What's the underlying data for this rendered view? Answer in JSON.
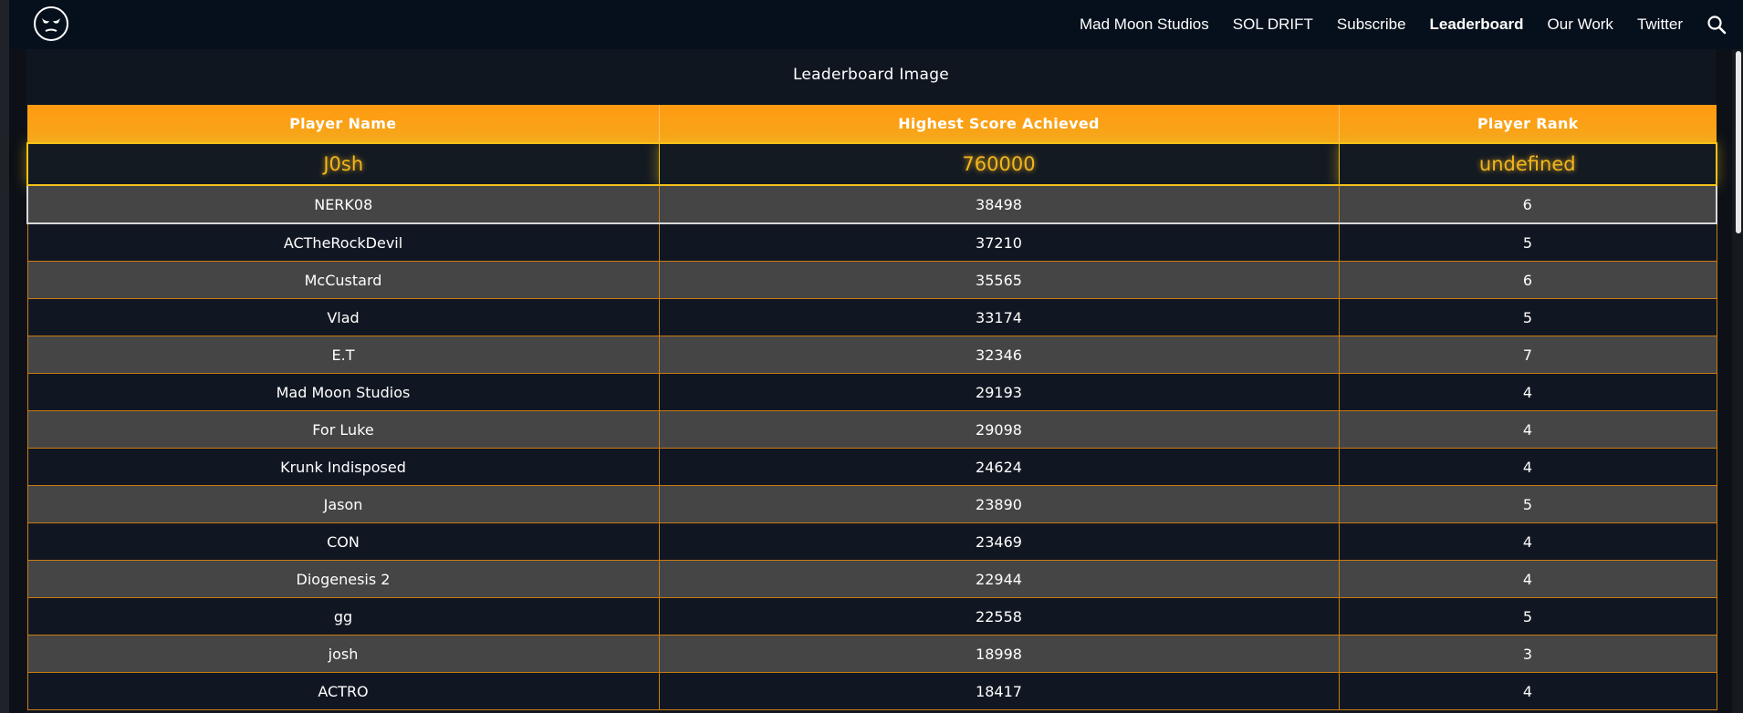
{
  "nav": {
    "logo_icon": "alien-face-icon",
    "links": [
      "Mad Moon Studios",
      "SOL DRIFT",
      "Subscribe",
      "Leaderboard",
      "Our Work",
      "Twitter"
    ],
    "active_link": "Leaderboard",
    "search_icon": "search-icon"
  },
  "page": {
    "title": "Leaderboard Image"
  },
  "leaderboard": {
    "headers": [
      "Player Name",
      "Highest Score Achieved",
      "Player Rank"
    ],
    "highlight": {
      "name": "J0sh",
      "score": "760000",
      "rank": "undefined"
    },
    "rows": [
      {
        "name": "NERK08",
        "score": "38498",
        "rank": "6"
      },
      {
        "name": "ACTheRockDevil",
        "score": "37210",
        "rank": "5"
      },
      {
        "name": "McCustard",
        "score": "35565",
        "rank": "6"
      },
      {
        "name": "Vlad",
        "score": "33174",
        "rank": "5"
      },
      {
        "name": "E.T",
        "score": "32346",
        "rank": "7"
      },
      {
        "name": "Mad Moon Studios",
        "score": "29193",
        "rank": "4"
      },
      {
        "name": "For Luke",
        "score": "29098",
        "rank": "4"
      },
      {
        "name": "Krunk Indisposed",
        "score": "24624",
        "rank": "4"
      },
      {
        "name": "Jason",
        "score": "23890",
        "rank": "5"
      },
      {
        "name": "CON",
        "score": "23469",
        "rank": "4"
      },
      {
        "name": "Diogenesis 2",
        "score": "22944",
        "rank": "4"
      },
      {
        "name": "gg",
        "score": "22558",
        "rank": "5"
      },
      {
        "name": "josh",
        "score": "18998",
        "rank": "3"
      },
      {
        "name": "ACTRO",
        "score": "18417",
        "rank": "4"
      }
    ]
  },
  "colors": {
    "accent": "#ff9a10",
    "highlight_text": "#f2b71c",
    "row_grey": "#454545",
    "row_dark": "#111722",
    "nav_bg": "#06101c"
  }
}
